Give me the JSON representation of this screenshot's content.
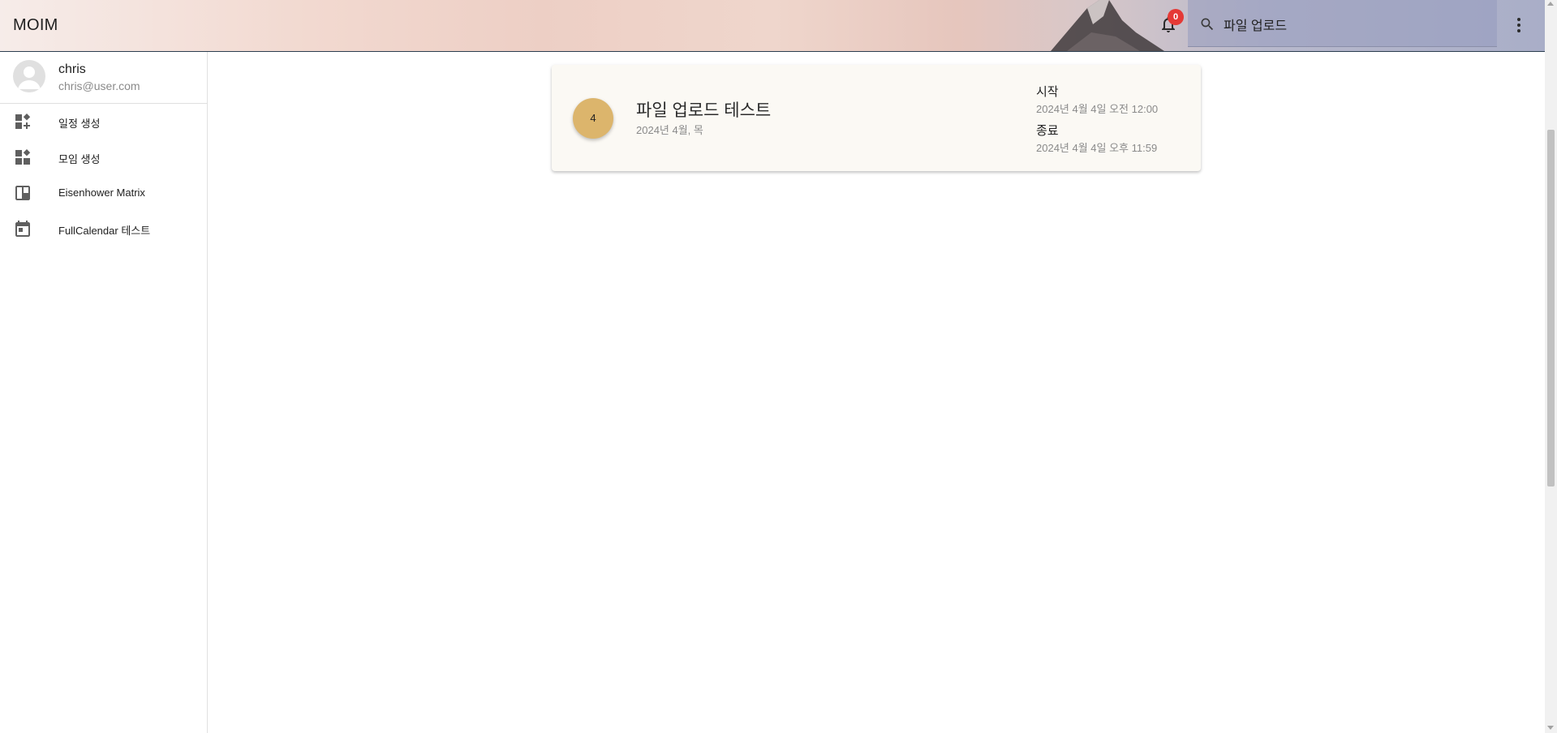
{
  "app": {
    "title": "MOIM"
  },
  "notifications": {
    "count": "0"
  },
  "search": {
    "value": "파일 업로드",
    "placeholder": ""
  },
  "user": {
    "name": "chris",
    "email": "chris@user.com"
  },
  "sidebar": {
    "items": [
      {
        "label": "일정 생성",
        "icon": "dashboard-customize-icon"
      },
      {
        "label": "모임 생성",
        "icon": "dashboard-customize-icon"
      },
      {
        "label": "Eisenhower Matrix",
        "icon": "board-icon"
      },
      {
        "label": "FullCalendar 테스트",
        "icon": "calendar-icon"
      }
    ]
  },
  "event": {
    "day": "4",
    "title": "파일 업로드 테스트",
    "subtitle": "2024년 4월, 목",
    "start_label": "시작",
    "start_value": "2024년 4월 4일 오전 12:00",
    "end_label": "종료",
    "end_value": "2024년 4월 4일 오후 11:59",
    "circle_color": "#dcb56c"
  },
  "colors": {
    "badge": "#e53935",
    "card_bg": "#fbf9f4"
  }
}
